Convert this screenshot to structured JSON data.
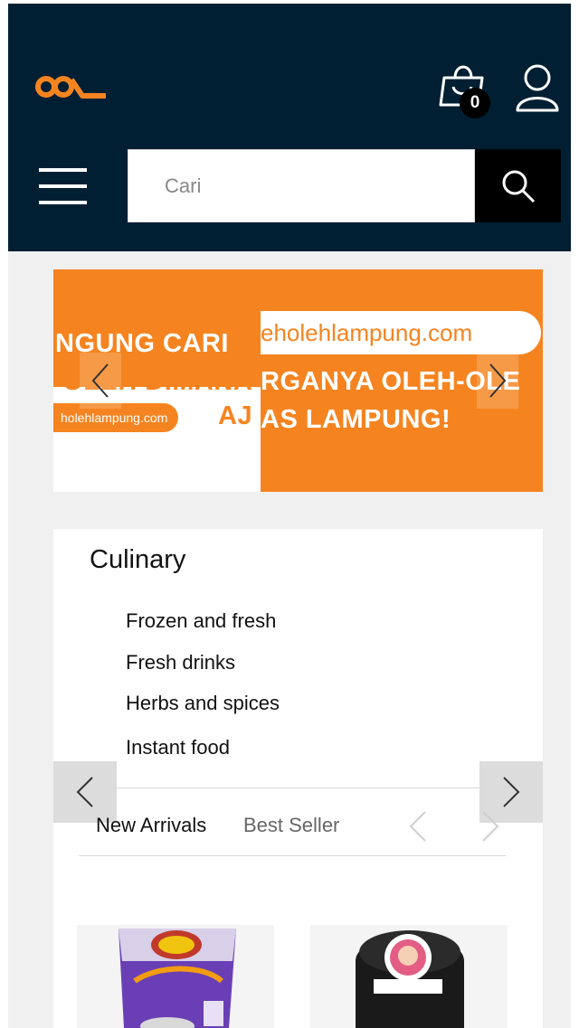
{
  "header": {
    "logo_alt": "logo",
    "cart_count": "0",
    "search": {
      "placeholder": "Cari"
    }
  },
  "banner": {
    "left_line1": "NGUNG CARI",
    "left_line2": "-OLEH DIMANA",
    "left_pill": "holehlampung.com",
    "left_line3": "AJ",
    "right_pill": "eholehlampung.com",
    "right_line1": "RGANYA OLEH-OLE",
    "right_line2": "AS LAMPUNG!"
  },
  "category": {
    "title": "Culinary",
    "items": [
      "Frozen and fresh",
      "Fresh drinks",
      "Herbs and spices",
      "Instant food"
    ]
  },
  "tabs": {
    "new_arrivals": "New Arrivals",
    "best_seller": "Best Seller"
  },
  "colors": {
    "header_bg": "#001f33",
    "brand_orange": "#f58420",
    "page_bg": "#f0f0f0"
  },
  "icons": [
    "logo-icon",
    "shopping-bag-icon",
    "user-icon",
    "menu-icon",
    "search-icon",
    "chevron-left-icon",
    "chevron-right-icon"
  ]
}
